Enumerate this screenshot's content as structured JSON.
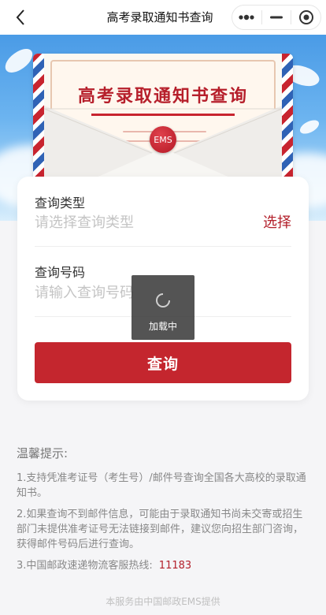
{
  "navbar": {
    "title": "高考录取通知书查询",
    "back_icon": "chevron-left-icon",
    "more_icon": "more-dots-icon",
    "minimize_icon": "minimize-icon",
    "close_icon": "target-close-icon"
  },
  "hero": {
    "letter_title": "高考录取通知书查询",
    "seal_text": "EMS"
  },
  "form": {
    "type_label": "查询类型",
    "type_placeholder": "请选择查询类型",
    "type_action": "选择",
    "number_label": "查询号码",
    "number_placeholder": "请输入查询号码",
    "submit_label": "查询"
  },
  "loading": {
    "text": "加载中"
  },
  "tips": {
    "title": "温馨提示:",
    "items": [
      "1.支持凭准考证号（考生号）/邮件号查询全国各大高校的录取通知书。",
      "2.如果查询不到邮件信息，可能由于录取通知书尚未交寄或招生部门未提供准考证号无法链接到邮件，建议您向招生部门咨询，获得邮件号码后进行查询。"
    ],
    "hotline_label": "3.中国邮政速递物流客服热线:",
    "hotline_number": "11183"
  },
  "footer": {
    "text": "本服务由中国邮政EMS提供"
  },
  "colors": {
    "brand_red": "#c4262e",
    "sky_blue": "#4a9be6",
    "placeholder_gray": "#c4c4c4"
  }
}
